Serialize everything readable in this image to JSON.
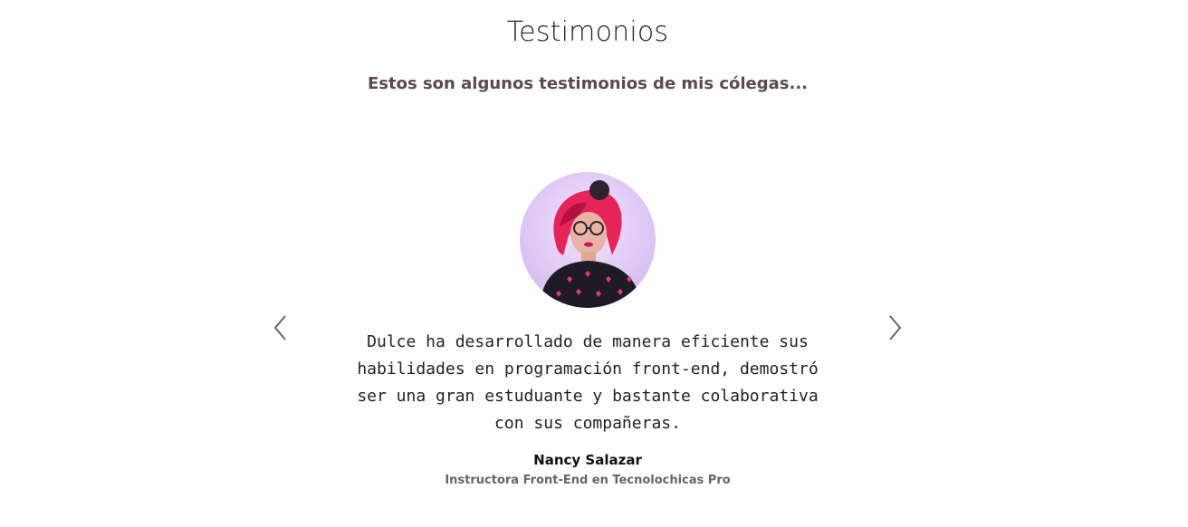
{
  "section": {
    "title": "Testimonios",
    "subtitle": "Estos son algunos testimonios de mis cólegas..."
  },
  "carousel": {
    "prev_icon": "chevron-left-icon",
    "next_icon": "chevron-right-icon",
    "testimonial": {
      "quote_lines": [
        "Dulce ha desarrollado de manera eficiente sus",
        "habilidades en programación front-end, demostró",
        "ser una gran estuduante y bastante colaborativa",
        "con sus compañeras."
      ],
      "author_name": "Nancy Salazar",
      "author_role": "Instructora Front-End en Tecnolochicas Pro"
    }
  },
  "colors": {
    "avatar_bg": "#dcc4f4",
    "hair": "#e6245a",
    "sweater": "#1e1b26",
    "arrow": "#666666"
  }
}
